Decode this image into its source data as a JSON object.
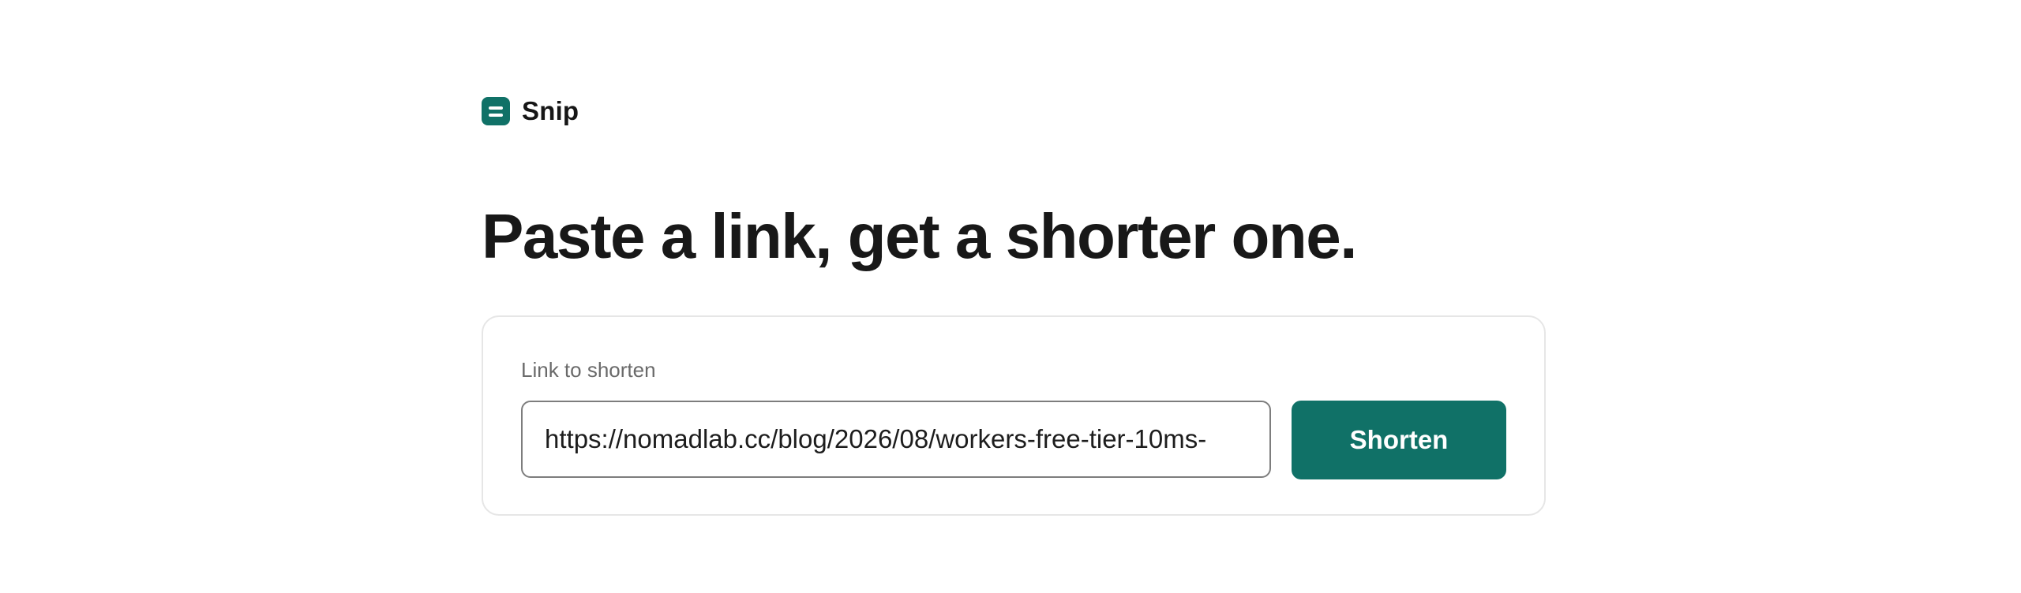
{
  "brand": {
    "logo_icon": "list-lines-icon",
    "name": "Snip",
    "accent_color": "#107167"
  },
  "hero": {
    "headline": "Paste a link, get a shorter one."
  },
  "form": {
    "label": "Link to shorten",
    "url_value": "https://nomadlab.cc/blog/2026/08/workers-free-tier-10ms-",
    "submit_label": "Shorten"
  }
}
